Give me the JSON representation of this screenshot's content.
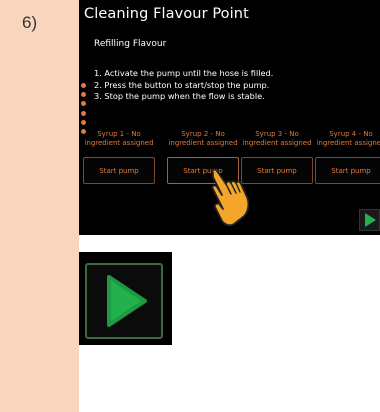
{
  "step": "6)",
  "screen": {
    "title": "Cleaning Flavour Point",
    "subtitle": "Refilling Flavour",
    "instructions": [
      "1. Activate the pump until the hose is filled.",
      "2. Press the button to start/stop the pump.",
      "3. Stop the pump when the flow is stable."
    ],
    "pumps": [
      {
        "label_line1": "Syrup 1 - No",
        "label_line2": "ingredient assigned",
        "button": "Start pump"
      },
      {
        "label_line1": "Syrup 2 - No",
        "label_line2": "ingredient assigned",
        "button": "Start pump"
      },
      {
        "label_line1": "Syrup 3 - No",
        "label_line2": "ingredient assigned",
        "button": "Start pump"
      },
      {
        "label_line1": "Syrup 4 - No",
        "label_line2": "ingredient assigned",
        "button": "Start pump"
      }
    ],
    "next_icon": "play-icon",
    "pointer_icon": "hand-pointer-icon"
  },
  "zoom": {
    "icon": "play-icon"
  },
  "colors": {
    "left_column": "#f8d5bd",
    "screen_bg": "#000000",
    "accent_orange": "#e07a3a",
    "dot_orange": "#e8744a",
    "play_green": "#22b14c",
    "hand_fill": "#f4a62a"
  }
}
